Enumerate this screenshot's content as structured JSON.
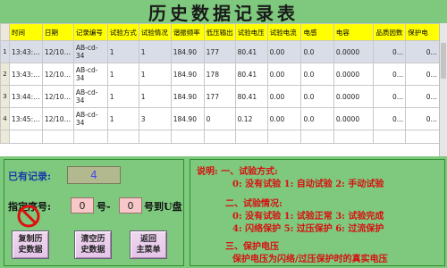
{
  "title": "历史数据记录表",
  "table": {
    "columns": [
      "时间",
      "日期",
      "记录编号",
      "试验方式",
      "试验情况",
      "谐振频率",
      "低压输出",
      "试验电压",
      "试验电流",
      "电感",
      "电容",
      "品质因数",
      "保护电"
    ],
    "rows": [
      {
        "index": "1",
        "cells": [
          "13:43:…",
          "12/10…",
          "AB-cd-34",
          "1",
          "1",
          "184.90",
          "177",
          "80.41",
          "0.00",
          "0.0",
          "0.0000",
          "0…",
          "0…"
        ]
      },
      {
        "index": "2",
        "cells": [
          "13:43:…",
          "12/10…",
          "AB-cd-34",
          "1",
          "1",
          "184.90",
          "178",
          "80.41",
          "0.00",
          "0.0",
          "0.0000",
          "0…",
          "0…"
        ]
      },
      {
        "index": "3",
        "cells": [
          "13:44:…",
          "12/10…",
          "AB-cd-34",
          "1",
          "1",
          "184.90",
          "177",
          "80.41",
          "0.00",
          "0.0",
          "0.0000",
          "0…",
          "0…"
        ]
      },
      {
        "index": "4",
        "cells": [
          "13:45:…",
          "12/10…",
          "AB-cd-34",
          "1",
          "3",
          "184.90",
          "0",
          "0.12",
          "0.00",
          "0.0",
          "0.0000",
          "0…",
          "0…"
        ]
      }
    ]
  },
  "left": {
    "existing_label": "已有记录:",
    "existing_count": "4",
    "range_label": "指定序号:",
    "from_value": "0",
    "to_label": "号-",
    "to_value": "0",
    "to_u_label": "号到U盘",
    "buttons": {
      "copy": "复制历\n史数据",
      "clear": "清空历\n史数据",
      "back": "返回\n主菜单"
    }
  },
  "notes": {
    "h1": "说明: 一、试验方式:",
    "l1": "0: 没有试验  1: 自动试验  2: 手动试验",
    "h2": "二、试验情况:",
    "l2": "0: 没有试验 1: 试验正常 3: 试验完成",
    "l3": "4: 闪络保护 5: 过压保护 6: 过流保护",
    "h3": "三、保护电压",
    "l4": "保护电压为闪络/过压保护时的真实电压"
  },
  "colors": {
    "background": "#7ec97e",
    "header_yellow": "#ffff00",
    "notes_red": "#d81010",
    "label_blue": "#1a3aa8",
    "button_pink": "#e8cce8",
    "input_pink": "#f8c8c8"
  }
}
